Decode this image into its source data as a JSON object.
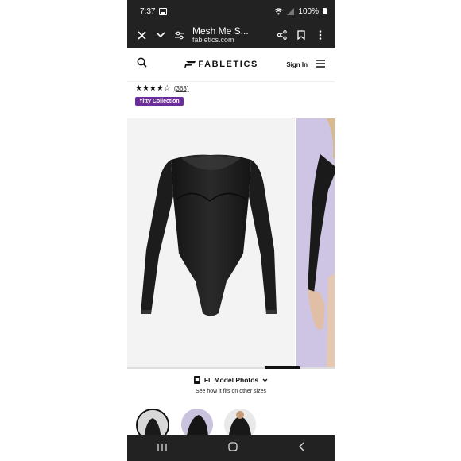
{
  "status_bar": {
    "time": "7:37",
    "battery": "100%"
  },
  "browser": {
    "page_title": "Mesh Me S...",
    "domain": "fabletics.com"
  },
  "site": {
    "logo_text": "FABLETICS",
    "sign_in": "Sign In"
  },
  "product": {
    "stars": "★★★★☆",
    "rating": 4,
    "review_count": "(363)",
    "collection_badge": "Yitty Collection"
  },
  "gallery": {
    "scroll_progress": 0.68
  },
  "fl_photos": {
    "title": "FL Model Photos",
    "subtitle": "See how it fits on other sizes"
  },
  "icons": {
    "close": "close-icon",
    "dropdown": "chevron-down-icon",
    "tune": "tune-icon",
    "share": "share-icon",
    "bookmark": "bookmark-icon",
    "more": "more-vertical-icon",
    "search": "search-icon",
    "menu": "hamburger-menu-icon",
    "nav_recent": "recent-apps-icon",
    "nav_home": "home-icon",
    "nav_back": "back-icon"
  },
  "colors": {
    "badge": "#6a2d9b",
    "chrome": "#222222",
    "side_image_bg": "#cdc5e3"
  }
}
